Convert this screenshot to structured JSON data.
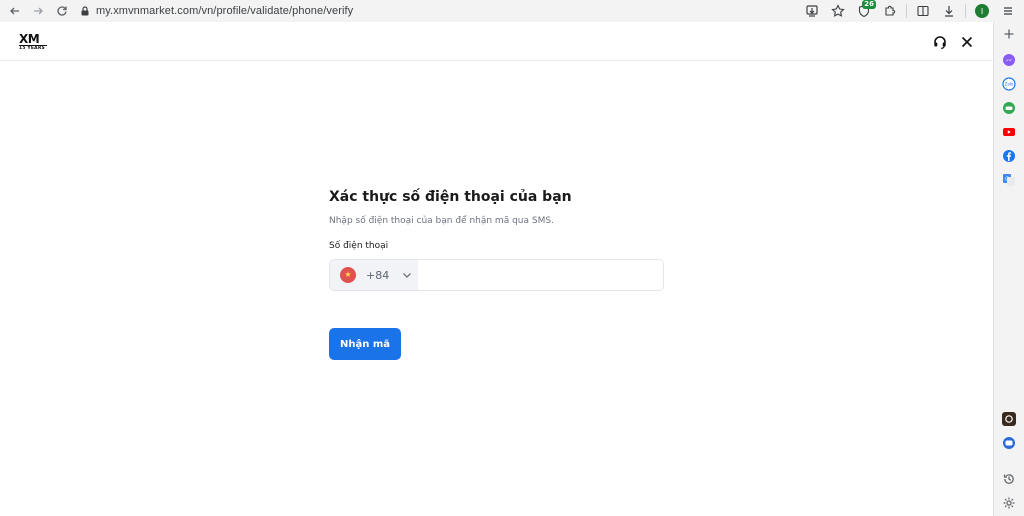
{
  "browser": {
    "url": "my.xmvnmarket.com/vn/profile/validate/phone/verify",
    "extension_badge": "26",
    "profile_initial": "I"
  },
  "header": {
    "logo_top": "XM",
    "logo_bottom": "15 YEARS"
  },
  "form": {
    "title": "Xác thực số điện thoại của bạn",
    "subtitle": "Nhập số điện thoại của bạn để nhận mã qua SMS.",
    "phone_label": "Số điện thoại",
    "dial_code": "+84",
    "phone_value": "",
    "phone_placeholder": "",
    "submit_label": "Nhận mã"
  },
  "colors": {
    "accent": "#1a73e8",
    "flag_red": "#e0524f",
    "flag_star": "#ffd84d"
  },
  "sidebar": {
    "items": [
      "add-icon",
      "messenger-icon",
      "zalo-icon",
      "game-controller-icon",
      "youtube-icon",
      "facebook-icon",
      "translate-icon",
      "extension-icon",
      "chat-icon",
      "history-icon",
      "settings-icon"
    ]
  }
}
